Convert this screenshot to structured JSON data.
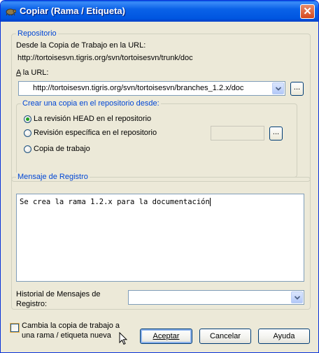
{
  "window": {
    "title": "Copiar (Rama / Etiqueta)",
    "close_glyph": "✕"
  },
  "repository": {
    "legend": "Repositorio",
    "from_label": "Desde la Copia de Trabajo en la URL:",
    "from_url": "http://tortoisesvn.tigris.org/svn/tortoisesvn/trunk/doc",
    "to_label_underlined": "A",
    "to_label_rest": " la URL:",
    "to_url_value": "http://tortoisesvn.tigris.org/svn/tortoisesvn/branches_1.2.x/doc",
    "browse_label": "...",
    "copy_from": {
      "legend": "Crear una copia en el repositorio desde:",
      "options": [
        {
          "label": "La revisión HEAD en el repositorio",
          "selected": true
        },
        {
          "label": "Revisión específica en el repositorio",
          "selected": false
        },
        {
          "label": "Copia de trabajo",
          "selected": false
        }
      ],
      "revision_value": "",
      "revision_browse_label": "..."
    }
  },
  "log": {
    "legend": "Mensaje de Registro",
    "message": "Se crea la rama 1.2.x para la documentación",
    "history_label_line1": "Historial de Mensajes de",
    "history_label_line2": "Registro:",
    "history_value": ""
  },
  "footer": {
    "switch_checkbox_line1": "Cambia la copia de trabajo a",
    "switch_checkbox_line2": "una rama / etiqueta nueva",
    "switch_checked": false,
    "accept_label": "Aceptar",
    "cancel_label": "Cancelar",
    "help_label": "Ayuda"
  },
  "colors": {
    "titlebar": "#0055e0",
    "legend_text": "#0046d5",
    "radio_selected": "#21a121",
    "dialog_bg": "#ece9d8"
  },
  "icons": {
    "app": "tortoisesvn-icon",
    "close": "close-icon",
    "dropdown": "chevron-down-icon",
    "pointer": "mouse-pointer-icon"
  }
}
